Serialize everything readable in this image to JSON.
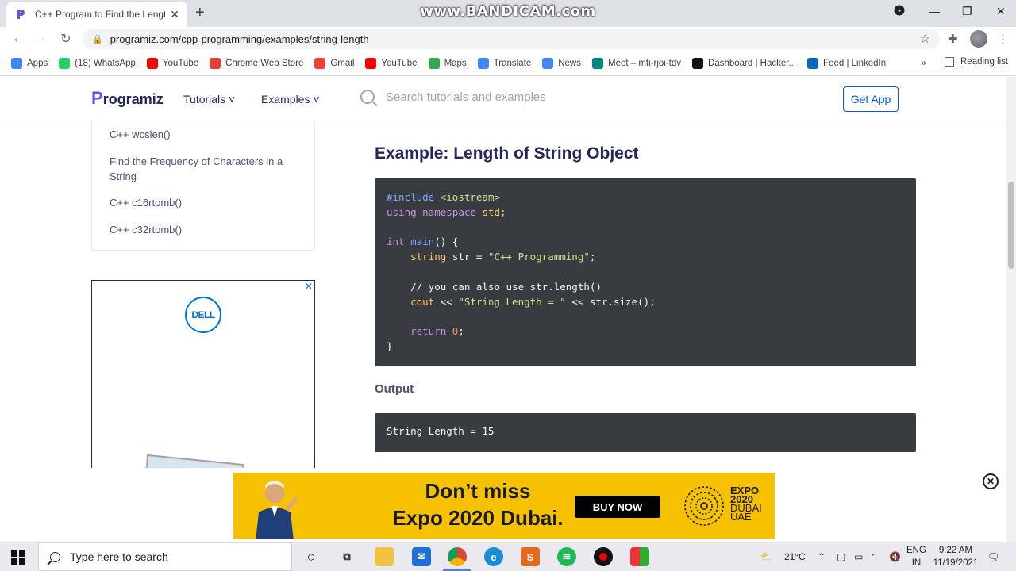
{
  "browser": {
    "tab_title": "C++ Program to Find the Length",
    "new_tab": "+",
    "url": "programiz.com/cpp-programming/examples/string-length",
    "watermark": "www.BANDICAM.com",
    "bookmarks": [
      {
        "label": "Apps",
        "color": "#4285f4",
        "icon": "apps-icon"
      },
      {
        "label": "(18) WhatsApp",
        "color": "#25d366",
        "icon": "whatsapp-icon"
      },
      {
        "label": "YouTube",
        "color": "#ff0000",
        "icon": "youtube-icon"
      },
      {
        "label": "Chrome Web Store",
        "color": "#e34133",
        "icon": "chrome-web-store-icon"
      },
      {
        "label": "Gmail",
        "color": "#ea4335",
        "icon": "gmail-icon"
      },
      {
        "label": "YouTube",
        "color": "#ff0000",
        "icon": "youtube-icon"
      },
      {
        "label": "Maps",
        "color": "#34a853",
        "icon": "maps-icon"
      },
      {
        "label": "Translate",
        "color": "#4285f4",
        "icon": "translate-icon"
      },
      {
        "label": "News",
        "color": "#4285f4",
        "icon": "news-icon"
      },
      {
        "label": "Meet – mti-rjoi-tdv",
        "color": "#00897b",
        "icon": "meet-icon"
      },
      {
        "label": "Dashboard | Hacker...",
        "color": "#111111",
        "icon": "hackerrank-icon"
      },
      {
        "label": "Feed | LinkedIn",
        "color": "#0a66c2",
        "icon": "linkedin-icon"
      }
    ],
    "bookmarks_more": "»",
    "reading_list": "Reading list"
  },
  "site": {
    "logo": "rogramiz",
    "logo_p": "P",
    "nav": {
      "tutorials": "Tutorials ˅",
      "examples": "Examples ˅"
    },
    "search_placeholder": "Search tutorials and examples",
    "get_app": "Get App",
    "sidebar": [
      "C++ wcslen()",
      "Find the Frequency of Characters in a String",
      "C++ c16rtomb()",
      "C++ c32rtomb()"
    ],
    "ad": {
      "brand": "DELL",
      "close": "✕"
    },
    "heading": "Example: Length of String Object",
    "output_heading": "Output",
    "output_text": "String Length = 15"
  },
  "code": {
    "l1a": "#include",
    "l1b": " <iostream>",
    "l2a": "using",
    "l2b": " namespace",
    "l2c": " std;",
    "l4a": "int",
    "l4b": " main",
    "l4c": "() {",
    "l5a": "    string",
    "l5b": " str = ",
    "l5c": "\"C++ Programming\"",
    "l5d": ";",
    "l7": "    // you can also use str.length()",
    "l8a": "    cout",
    "l8b": " << ",
    "l8c": "\"String Length = \"",
    "l8d": " << str.size();",
    "l10a": "    return",
    "l10b": " 0",
    "l10c": ";",
    "l11": "}"
  },
  "banner": {
    "line1": "Don’t miss",
    "line2": "Expo 2020 Dubai.",
    "buy_now": "BUY NOW",
    "expo_line1": "EXPO",
    "expo_line2": "2020",
    "expo_line3": "DUBAI",
    "expo_line4": "UAE",
    "close": "✕"
  },
  "taskbar": {
    "search_placeholder": "Type here to search",
    "weather": "21°C",
    "lang_line1": "ENG",
    "lang_line2": "IN",
    "time": "9:22 AM",
    "date": "11/19/2021"
  }
}
